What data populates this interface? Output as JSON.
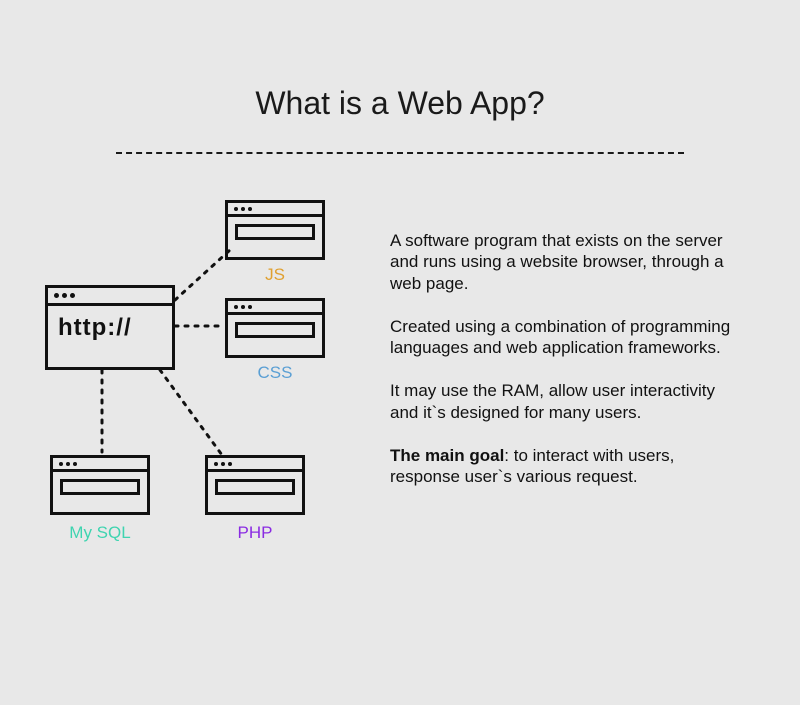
{
  "title": "What is a Web App?",
  "mainNode": {
    "label": "http://"
  },
  "nodes": {
    "js": {
      "label": "JS",
      "color": "#e0a030"
    },
    "css": {
      "label": "CSS",
      "color": "#5a9fd4"
    },
    "php": {
      "label": "PHP",
      "color": "#8a2be2"
    },
    "mysql": {
      "label": "My SQL",
      "color": "#3fd4b0"
    }
  },
  "paragraphs": {
    "p1": "A software program that exists on the server and runs using a website browser, through a web page.",
    "p2": "Created using a combination of programming languages and web application frameworks.",
    "p3": "It may use the RAM, allow user interactivity and it`s designed for many users.",
    "p4_bold": "The main goal",
    "p4_rest": ": to interact with users, response user`s various request."
  }
}
